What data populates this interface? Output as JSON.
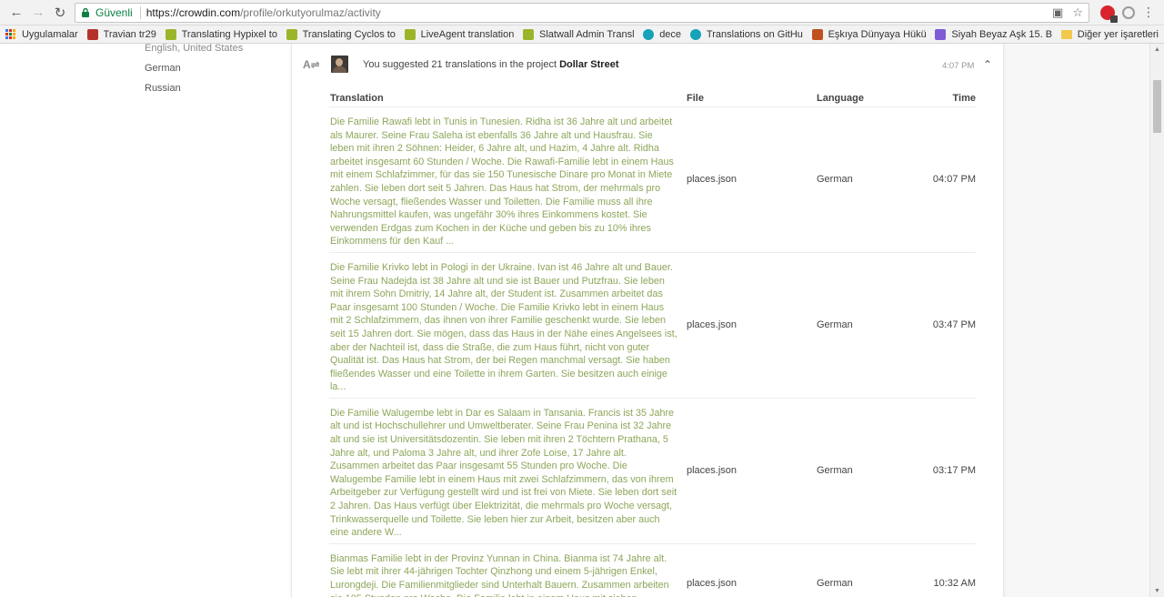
{
  "browser": {
    "secure_label": "Güvenli",
    "url_host": "https://crowdin.com",
    "url_path": "/profile/orkutyorulmaz/activity"
  },
  "bookmarks": {
    "apps_label": "Uygulamalar",
    "items": [
      {
        "label": "Travian tr29",
        "color": "#b5322a"
      },
      {
        "label": "Translating Hypixel to",
        "color": "#9bb52a"
      },
      {
        "label": "Translating Cyclos to",
        "color": "#9bb52a"
      },
      {
        "label": "LiveAgent translation",
        "color": "#9bb52a"
      },
      {
        "label": "Slatwall Admin Transl",
        "color": "#9bb52a"
      },
      {
        "label": "dece",
        "color": "#17a2b8"
      },
      {
        "label": "Translations on GitHu",
        "color": "#17a2b8"
      },
      {
        "label": "Eşkıya Dünyaya Hükü",
        "color": "#c0501f"
      },
      {
        "label": "Siyah Beyaz Aşk 15. B",
        "color": "#7f5bd5"
      }
    ],
    "other_label": "Diğer yer işaretleri"
  },
  "sidebar": {
    "languages": [
      "English, United States",
      "German",
      "Russian"
    ]
  },
  "activity": {
    "summary_prefix": "You suggested 21 translations in the project ",
    "project": "Dollar Street",
    "time": "4:07 PM",
    "columns": {
      "translation": "Translation",
      "file": "File",
      "language": "Language",
      "time": "Time"
    },
    "rows": [
      {
        "text": "Die Familie Rawafi lebt in Tunis in Tunesien. Ridha ist 36 Jahre alt und arbeitet als Maurer. Seine Frau Saleha ist ebenfalls 36 Jahre alt und Hausfrau. Sie leben mit ihren 2 Söhnen: Heider, 6 Jahre alt, und Hazim, 4 Jahre alt. Ridha arbeitet insgesamt 60 Stunden / Woche. Die Rawafi-Familie lebt in einem Haus mit einem Schlafzimmer, für das sie 150 Tunesische Dinare pro Monat in Miete zahlen. Sie leben dort seit 5 Jahren. Das Haus hat Strom, der mehrmals pro Woche versagt, fließendes Wasser und Toiletten. Die Familie muss all ihre Nahrungsmittel kaufen, was ungefähr 30% ihres Einkommens kostet. Sie verwenden Erdgas zum Kochen in der Küche und geben bis zu 10% ihres Einkommens für den Kauf ...",
        "file": "places.json",
        "language": "German",
        "time": "04:07 PM"
      },
      {
        "text": "Die Familie Krivko lebt in Pologi in der Ukraine. Ivan ist 46 Jahre alt und Bauer. Seine Frau Nadejda ist 38 Jahre alt und sie ist Bauer und Putzfrau. Sie leben mit ihrem Sohn Dmitriy, 14 Jahre alt, der Student ist. Zusammen arbeitet das Paar insgesamt 100 Stunden / Woche. Die Familie Krivko lebt in einem Haus mit 2 Schlafzimmern, das ihnen von ihrer Familie geschenkt wurde. Sie leben seit 15 Jahren dort. Sie mögen, dass das Haus in der Nähe eines Angelsees ist, aber der Nachteil ist, dass die Straße, die zum Haus führt, nicht von guter Qualität ist. Das Haus hat Strom, der bei Regen manchmal versagt. Sie haben fließendes Wasser und eine Toilette in ihrem Garten. Sie besitzen auch einige la...",
        "file": "places.json",
        "language": "German",
        "time": "03:47 PM"
      },
      {
        "text": "Die Familie Walugembe lebt in Dar es Salaam in Tansania. Francis ist 35 Jahre alt und ist Hochschullehrer und Umweltberater. Seine Frau Penina ist 32 Jahre alt und sie ist Universitätsdozentin. Sie leben mit ihren 2 Töchtern Prathana, 5 Jahre alt, und Paloma 3 Jahre alt, und ihrer Zofe Loise, 17 Jahre alt. Zusammen arbeitet das Paar insgesamt 55 Stunden pro Woche. Die Walugembe Familie lebt in einem Haus mit zwei Schlafzimmern, das von ihrem Arbeitgeber zur Verfügung gestellt wird und ist frei von Miete. Sie leben dort seit 2 Jahren. Das Haus verfügt über Elektrizität, die mehrmals pro Woche versagt, Trinkwasserquelle und Toilette. Sie leben hier zur Arbeit, besitzen aber auch eine andere W...",
        "file": "places.json",
        "language": "German",
        "time": "03:17 PM"
      },
      {
        "text": "Bianmas Familie lebt in der Provinz Yunnan in China. Bianma ist 74 Jahre alt. Sie lebt mit ihrer 44-jährigen Tochter Qinzhong und einem 5-jährigen Enkel, Lurongdeji. Die Familienmitglieder sind Unterhalt Bauern. Zusammen arbeiten sie 105 Stunden pro Woche. Die Familie lebt in einem Haus mit sieben Schlafzimmern. Sie besitzen das Haus und leben seit 2 Jahren dort. Sie mögen",
        "file": "places.json",
        "language": "German",
        "time": "10:32 AM"
      }
    ]
  }
}
